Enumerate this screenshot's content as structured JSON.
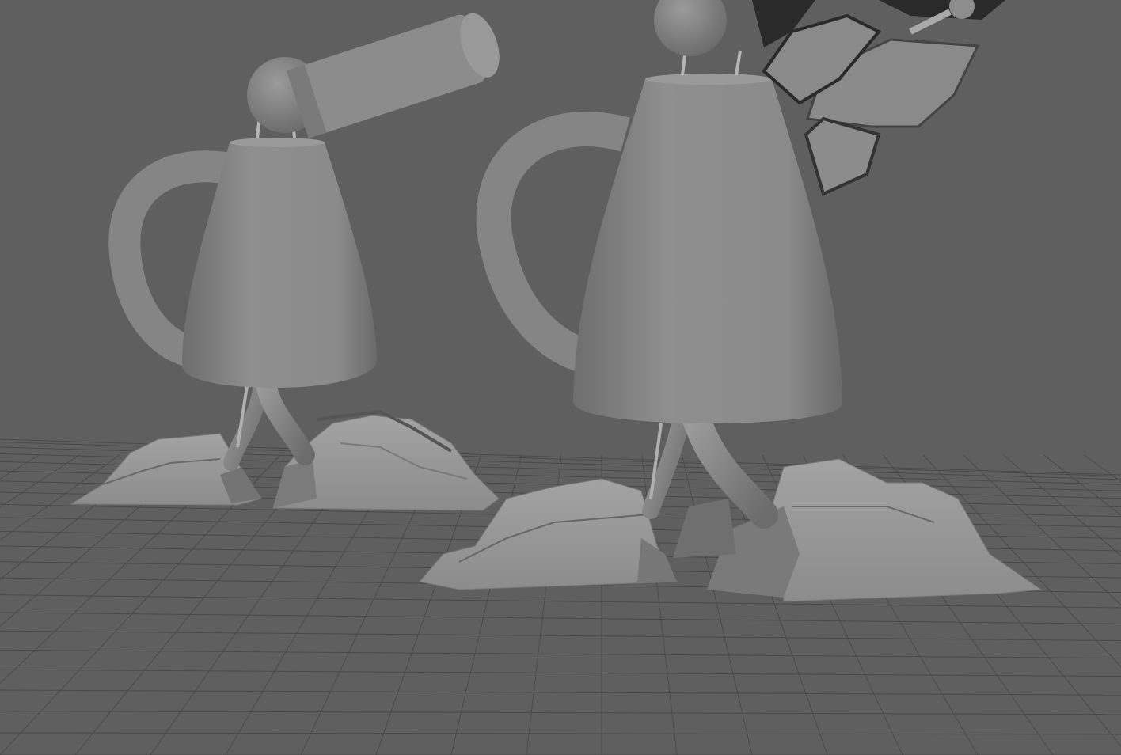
{
  "viewport": {
    "background_color": "#5f5f5f",
    "grid_line_color": "#4a4a4a",
    "model_fill_color": "#8e8e8e",
    "model_shadow_color": "#5a5a5a",
    "shading_mode": "default-gray-shaded"
  },
  "scene": {
    "objects": [
      {
        "name": "ground-grid"
      },
      {
        "name": "robot-left"
      },
      {
        "name": "robot-right"
      }
    ]
  }
}
